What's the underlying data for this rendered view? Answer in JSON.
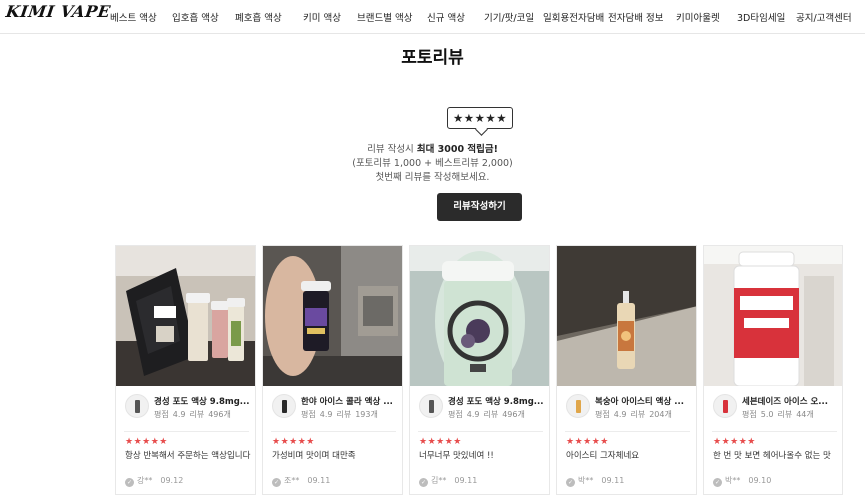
{
  "header": {
    "logo": "KIMI VAPE",
    "nav": [
      {
        "label": "베스트 액상"
      },
      {
        "label": "입호흡 액상"
      },
      {
        "label": "폐호흡 액상"
      },
      {
        "label": "키미 액상"
      },
      {
        "label": "브랜드별 액상"
      },
      {
        "label": "신규 액상"
      },
      {
        "label": "기기/팟/코일"
      },
      {
        "label": "일회용전자담배"
      },
      {
        "label": "전자담배 정보"
      },
      {
        "label": "키미아울렛"
      },
      {
        "label": "3D타임세일"
      },
      {
        "label": "공지/고객센터"
      }
    ]
  },
  "page": {
    "title": "포토리뷰"
  },
  "promo": {
    "stars": "★★★★★",
    "line1_prefix": "리뷰 작성시 ",
    "line1_bold": "최대 3000 적립금!",
    "line2": "(포토리뷰 1,000 + 베스트리뷰 2,000)",
    "line3": "첫번째 리뷰를 작성해보세요.",
    "button": "리뷰작성하기"
  },
  "reviews": [
    {
      "product_name": "경성 포도 액상 9.8mg...",
      "rating_label": "평점",
      "rating": "4.9",
      "review_count_label": "리뷰",
      "review_count": "496개",
      "stars": "★★★★★",
      "text": "항상 반복해서 주문하는 액상입니다",
      "author": "강**",
      "date": "09.12"
    },
    {
      "product_name": "한야 아이스 콜라 액상 ...",
      "rating_label": "평점",
      "rating": "4.9",
      "review_count_label": "리뷰",
      "review_count": "193개",
      "stars": "★★★★★",
      "text": "가성비며 맛이며 대만족",
      "author": "조**",
      "date": "09.11"
    },
    {
      "product_name": "경성 포도 액상 9.8mg...",
      "rating_label": "평점",
      "rating": "4.9",
      "review_count_label": "리뷰",
      "review_count": "496개",
      "stars": "★★★★★",
      "text": "너무너무 맛있네여 !!",
      "author": "김**",
      "date": "09.11"
    },
    {
      "product_name": "복숭아 아이스티 액상 ...",
      "rating_label": "평점",
      "rating": "4.9",
      "review_count_label": "리뷰",
      "review_count": "204개",
      "stars": "★★★★★",
      "text": "아이스티 그자체네요",
      "author": "박**",
      "date": "09.11"
    },
    {
      "product_name": "세븐데이즈 아이스 오...",
      "rating_label": "평점",
      "rating": "5.0",
      "review_count_label": "리뷰",
      "review_count": "44개",
      "stars": "★★★★★",
      "text": "한 번 맛 보면 헤어나올수 없는 맛",
      "author": "박**",
      "date": "09.10"
    }
  ]
}
